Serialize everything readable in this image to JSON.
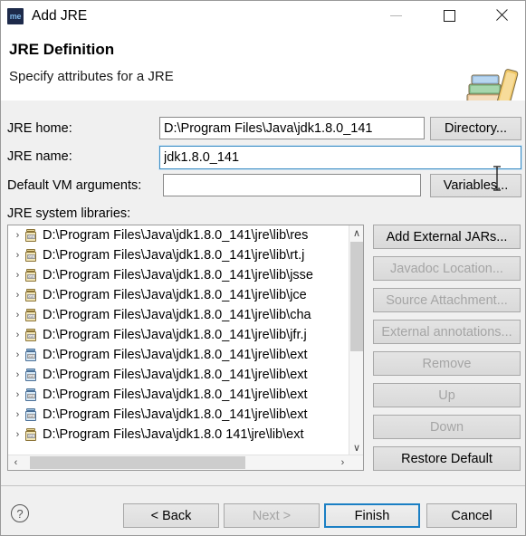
{
  "window": {
    "title": "Add JRE",
    "app_icon": "me",
    "minimize_label": "Minimize",
    "maximize_label": "Maximize",
    "close_label": "Close"
  },
  "header": {
    "title": "JRE Definition",
    "subtitle": "Specify attributes for a JRE",
    "icon": "books-icon"
  },
  "form": {
    "jre_home_label": "JRE home:",
    "jre_home_value": "D:\\Program Files\\Java\\jdk1.8.0_141",
    "jre_home_placeholder": "",
    "jre_name_label": "JRE name:",
    "jre_name_value": "jdk1.8.0_141",
    "jre_name_placeholder": "",
    "vm_args_label": "Default VM arguments:",
    "vm_args_value": "",
    "vm_args_placeholder": "",
    "directory_button": "Directory...",
    "variables_button": "Variables...",
    "libraries_label": "JRE system libraries:"
  },
  "libraries": [
    {
      "text": "D:\\Program Files\\Java\\jdk1.8.0_141\\jre\\lib\\res",
      "icon": "jar-icon",
      "variant": "tan"
    },
    {
      "text": "D:\\Program Files\\Java\\jdk1.8.0_141\\jre\\lib\\rt.j",
      "icon": "jar-icon",
      "variant": "tan"
    },
    {
      "text": "D:\\Program Files\\Java\\jdk1.8.0_141\\jre\\lib\\jsse",
      "icon": "jar-icon",
      "variant": "tan"
    },
    {
      "text": "D:\\Program Files\\Java\\jdk1.8.0_141\\jre\\lib\\jce",
      "icon": "jar-icon",
      "variant": "tan"
    },
    {
      "text": "D:\\Program Files\\Java\\jdk1.8.0_141\\jre\\lib\\cha",
      "icon": "jar-icon",
      "variant": "tan"
    },
    {
      "text": "D:\\Program Files\\Java\\jdk1.8.0_141\\jre\\lib\\jfr.j",
      "icon": "jar-icon",
      "variant": "tan"
    },
    {
      "text": "D:\\Program Files\\Java\\jdk1.8.0_141\\jre\\lib\\ext",
      "icon": "jar-icon",
      "variant": "blue"
    },
    {
      "text": "D:\\Program Files\\Java\\jdk1.8.0_141\\jre\\lib\\ext",
      "icon": "jar-icon",
      "variant": "blue"
    },
    {
      "text": "D:\\Program Files\\Java\\jdk1.8.0_141\\jre\\lib\\ext",
      "icon": "jar-icon",
      "variant": "blue"
    },
    {
      "text": "D:\\Program Files\\Java\\jdk1.8.0_141\\jre\\lib\\ext",
      "icon": "jar-icon",
      "variant": "blue"
    },
    {
      "text": "D:\\Program Files\\Java\\jdk1.8.0 141\\jre\\lib\\ext",
      "icon": "jar-icon",
      "variant": "tan"
    }
  ],
  "list_icons": {
    "expand_arrow": "›",
    "jar_text": "010"
  },
  "scrollbars": {
    "v_up": "∧",
    "v_down": "∨",
    "h_left": "‹",
    "h_right": "›"
  },
  "side_buttons": [
    {
      "label": "Add External JARs...",
      "enabled": true
    },
    {
      "label": "Javadoc Location...",
      "enabled": false
    },
    {
      "label": "Source Attachment...",
      "enabled": false
    },
    {
      "label": "External annotations...",
      "enabled": false
    },
    {
      "label": "Remove",
      "enabled": false
    },
    {
      "label": "Up",
      "enabled": false
    },
    {
      "label": "Down",
      "enabled": false
    },
    {
      "label": "Restore Default",
      "enabled": true
    }
  ],
  "footer": {
    "help_icon": "?",
    "back": "< Back",
    "next": "Next >",
    "finish": "Finish",
    "cancel": "Cancel"
  },
  "colors": {
    "accent": "#1b7fc4",
    "focus_border": "#3a8cc4",
    "dialog_bg": "#f0f0f0",
    "titlebar_bg": "#ffffff",
    "app_icon_bg": "#1d2a4a",
    "app_icon_fg": "#7fb7e8"
  }
}
